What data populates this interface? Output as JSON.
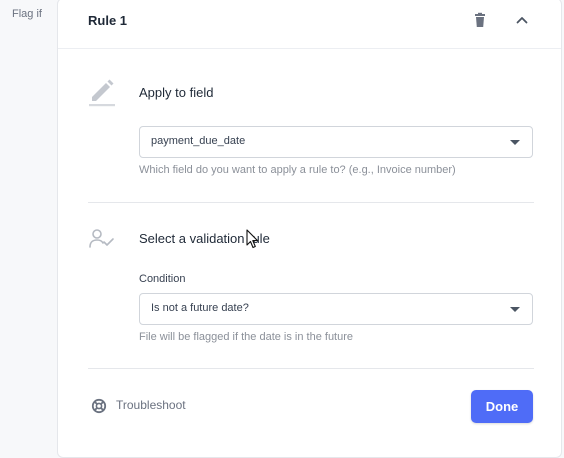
{
  "flag_label": "Flag if",
  "rule": {
    "title": "Rule 1",
    "delete_icon": "trash-icon",
    "collapse_icon": "chevron-up-icon"
  },
  "apply_field": {
    "title": "Apply to field",
    "icon": "pencil-icon",
    "selected": "payment_due_date",
    "help": "Which field do you want to apply a rule to? (e.g., Invoice number)"
  },
  "validation": {
    "title": "Select a validation rule",
    "icon": "user-check-icon",
    "condition_label": "Condition",
    "selected": "Is not a future date?",
    "help": "File will be flagged if the date is in the future"
  },
  "footer": {
    "troubleshoot_label": "Troubleshoot",
    "troubleshoot_icon": "lifebuoy-icon",
    "done_label": "Done"
  },
  "colors": {
    "primary": "#4f6cf7",
    "muted_text": "#8b9099"
  }
}
